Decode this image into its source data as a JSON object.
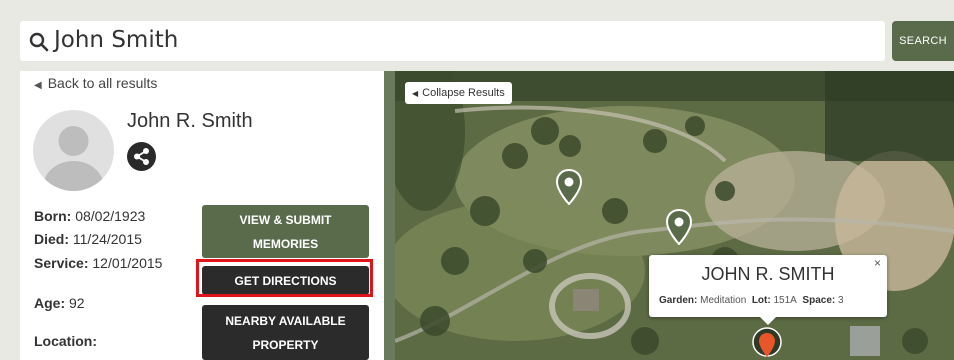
{
  "search": {
    "query": "John Smith",
    "button_label": "SEARCH"
  },
  "panel": {
    "back_link": "Back to all results",
    "name": "John R. Smith",
    "born_label": "Born:",
    "born_value": "08/02/1923",
    "died_label": "Died:",
    "died_value": "11/24/2015",
    "service_label": "Service:",
    "service_value": "12/01/2015",
    "age_label": "Age:",
    "age_value": "92",
    "location_label": "Location:",
    "buttons": {
      "memories_line1": "VIEW & SUBMIT",
      "memories_line2": "MEMORIES",
      "directions": "GET DIRECTIONS",
      "nearby_line1": "NEARBY AVAILABLE",
      "nearby_line2": "PROPERTY"
    }
  },
  "map": {
    "collapse_label": "Collapse Results",
    "popup": {
      "title": "JOHN R. SMITH",
      "close": "×",
      "garden_label": "Garden:",
      "garden_value": "Meditation",
      "lot_label": "Lot:",
      "lot_value": "151A",
      "space_label": "Space:",
      "space_value": "3"
    }
  },
  "colors": {
    "accent_green": "#5a6b4c",
    "dark_button": "#2b2b2b",
    "highlight_red": "#e0151b",
    "active_pin": "#e8562a"
  },
  "icons": [
    "search-icon",
    "share-icon",
    "back-arrow-icon",
    "collapse-arrow-icon",
    "map-pin-icon",
    "close-icon"
  ]
}
